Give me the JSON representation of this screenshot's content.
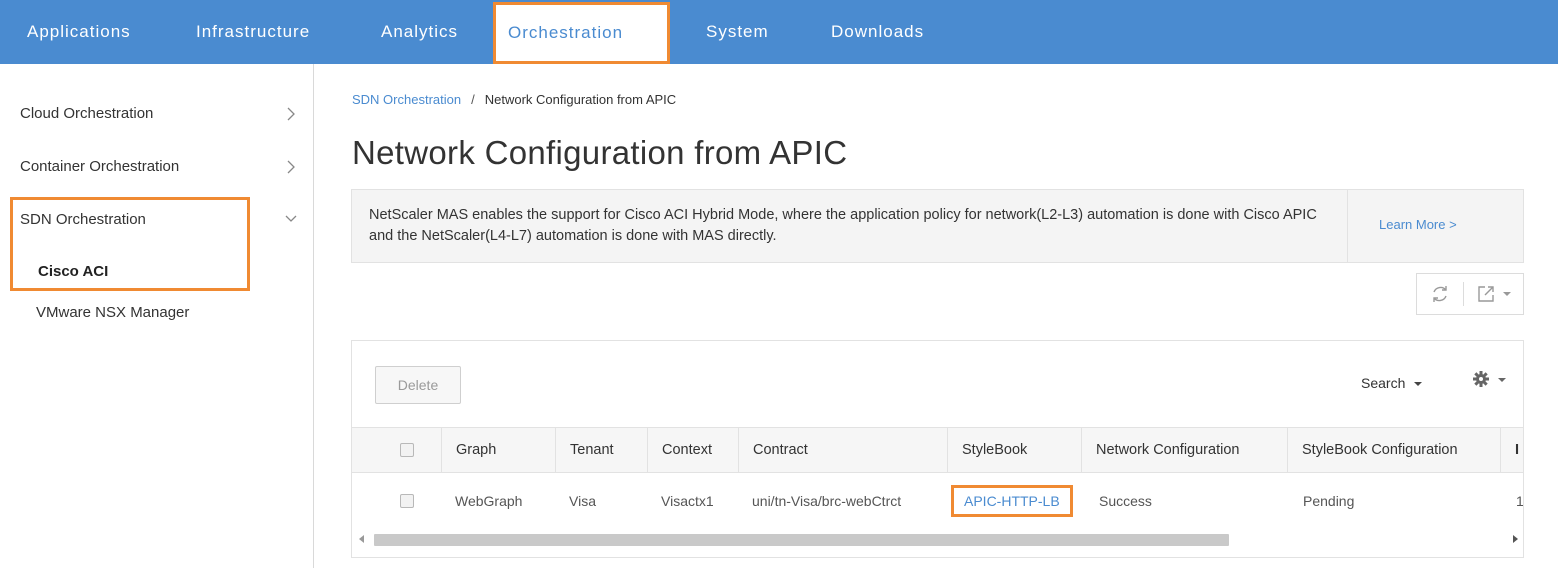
{
  "topnav": {
    "items": [
      {
        "label": "Applications"
      },
      {
        "label": "Infrastructure"
      },
      {
        "label": "Analytics"
      },
      {
        "label": "Orchestration",
        "active": true
      },
      {
        "label": "System"
      },
      {
        "label": "Downloads"
      }
    ]
  },
  "sidebar": {
    "items": [
      {
        "label": "Cloud Orchestration",
        "icon": "chevron-right-icon"
      },
      {
        "label": "Container Orchestration",
        "icon": "chevron-right-icon"
      },
      {
        "label": "SDN Orchestration",
        "icon": "chevron-down-icon",
        "expanded": true,
        "children": [
          {
            "label": "Cisco ACI",
            "selected": true
          },
          {
            "label": "VMware NSX Manager"
          }
        ]
      }
    ]
  },
  "breadcrumb": {
    "parent": "SDN Orchestration",
    "separator": "/",
    "current": "Network Configuration from APIC"
  },
  "page": {
    "title": "Network Configuration from APIC"
  },
  "info": {
    "text": "NetScaler MAS enables the support for Cisco ACI Hybrid Mode, where the application policy for network(L2-L3) automation is done with Cisco APIC and the NetScaler(L4-L7) automation is done with MAS directly.",
    "learn_more": "Learn More >"
  },
  "toolbar": {
    "refresh_icon": "refresh-icon",
    "export_icon": "export-icon"
  },
  "grid": {
    "delete_label": "Delete",
    "search_label": "Search",
    "columns": [
      "Graph",
      "Tenant",
      "Context",
      "Contract",
      "StyleBook",
      "Network Configuration",
      "StyleBook Configuration",
      "I"
    ],
    "rows": [
      {
        "graph": "WebGraph",
        "tenant": "Visa",
        "context": "Visactx1",
        "contract": "uni/tn-Visa/brc-webCtrct",
        "stylebook": "APIC-HTTP-LB",
        "network_config": "Success",
        "stylebook_config": "Pending",
        "extra": "1"
      }
    ]
  },
  "colors": {
    "nav_bg": "#4a8bd0",
    "highlight": "#f08a32",
    "link": "#4a8bd0",
    "success": "#3c8a2e",
    "pending": "#d0362c"
  }
}
